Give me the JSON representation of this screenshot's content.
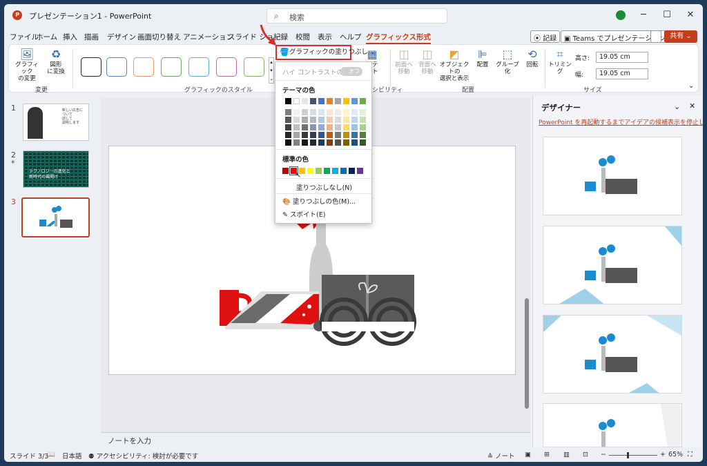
{
  "window": {
    "title": "プレゼンテーション1 - PowerPoint",
    "app_icon_letter": "P"
  },
  "search": {
    "placeholder": "検索"
  },
  "menu": {
    "tabs": [
      "ファイル",
      "ホーム",
      "挿入",
      "描画",
      "デザイン",
      "画面切り替え",
      "アニメーション",
      "スライド ショー",
      "記録",
      "校閲",
      "表示",
      "ヘルプ",
      "グラフィックス形式"
    ],
    "active_tab": "グラフィックス形式",
    "record_button": "記録",
    "teams_button": "Teams でプレゼンテーション",
    "share_button": "共有"
  },
  "ribbon": {
    "change_group": {
      "label": "変更",
      "btn1_line1": "グラフィック",
      "btn1_line2": "の変更",
      "btn2_line1": "図形",
      "btn2_line2": "に変換"
    },
    "styles_group": {
      "label": "グラフィックのスタイル",
      "swatch_colors": [
        "#222222",
        "#5a8ab8",
        "#e59a6a",
        "#6aa26a",
        "#5ab6d6",
        "#b86ab8",
        "#7ab86a"
      ]
    },
    "fill_button": "グラフィックの塗りつぶし",
    "alt_text_partial": "替テ",
    "alt_text_partial2": "スト",
    "accessibility_partial": "シビリティ",
    "arrange_group": {
      "label": "配置",
      "forward_line1": "前面へ",
      "forward_line2": "移動",
      "backward_line1": "背面へ",
      "backward_line2": "移動",
      "selection_line1": "オブジェクトの",
      "selection_line2": "選択と表示",
      "align": "配置",
      "group": "グループ化",
      "rotate": "回転"
    },
    "size_group": {
      "label": "サイズ",
      "crop": "トリミング",
      "height_label": "高さ:",
      "height_value": "19.05 cm",
      "width_label": "幅:",
      "width_value": "19.05 cm"
    }
  },
  "dropdown": {
    "high_contrast": "ハイ コントラストのみ(H)",
    "toggle_label": "オフ",
    "theme_colors_label": "テーマの色",
    "theme_top_row": [
      "#000000",
      "#ffffff",
      "#e7e6e6",
      "#44546a",
      "#4472c4",
      "#ed7d31",
      "#a5a5a5",
      "#ffc000",
      "#5b9bd5",
      "#70ad47"
    ],
    "theme_shades": [
      [
        "#7f7f7f",
        "#595959",
        "#404040",
        "#262626",
        "#0d0d0d"
      ],
      [
        "#f2f2f2",
        "#d9d9d9",
        "#bfbfbf",
        "#a6a6a6",
        "#808080"
      ],
      [
        "#d0cece",
        "#aeabab",
        "#757171",
        "#3a3838",
        "#171616"
      ],
      [
        "#d6dce4",
        "#adb9ca",
        "#8496b0",
        "#323f4f",
        "#222a35"
      ],
      [
        "#dae3f3",
        "#b4c7e7",
        "#8faadc",
        "#2f5597",
        "#1f3864"
      ],
      [
        "#fbe5d6",
        "#f8cbad",
        "#f4b183",
        "#c55a11",
        "#843c0c"
      ],
      [
        "#ededed",
        "#dbdbdb",
        "#c9c9c9",
        "#7b7b7b",
        "#525252"
      ],
      [
        "#fff2cc",
        "#ffe699",
        "#ffd966",
        "#bf9000",
        "#7f6000"
      ],
      [
        "#deebf7",
        "#bdd7ee",
        "#9dc3e6",
        "#2e75b6",
        "#1f4e79"
      ],
      [
        "#e2f0d9",
        "#c5e0b4",
        "#a9d18e",
        "#538135",
        "#375623"
      ]
    ],
    "standard_colors_label": "標準の色",
    "standard_colors": [
      "#c00000",
      "#ff0000",
      "#ffc000",
      "#ffff00",
      "#92d050",
      "#00b050",
      "#00b0f0",
      "#0070c0",
      "#002060",
      "#7030a0"
    ],
    "no_fill": "塗りつぶしなし(N)",
    "more_colors": "塗りつぶしの色(M)...",
    "eyedropper": "スポイト(E)"
  },
  "thumbnails": [
    {
      "num": "1",
      "text_line1": "新しい広告に",
      "text_line2": "ついて",
      "text_line3": "話して",
      "text_line4": "説明します"
    },
    {
      "num": "2",
      "star": "*",
      "text_line1": "テクノロジーの進化と",
      "text_line2": "新時代の幕開け"
    },
    {
      "num": "3"
    }
  ],
  "notes": {
    "placeholder": "ノートを入力"
  },
  "designer": {
    "title": "デザイナー",
    "stop_link": "PowerPoint を再起動するまでアイデアの候補表示を停止します。"
  },
  "status": {
    "slide": "スライド 3/3",
    "language": "日本語",
    "accessibility": "アクセシビリティ: 検討が必要です",
    "notes": "ノート",
    "zoom": "65%",
    "zoom_fraction": 0.37
  }
}
